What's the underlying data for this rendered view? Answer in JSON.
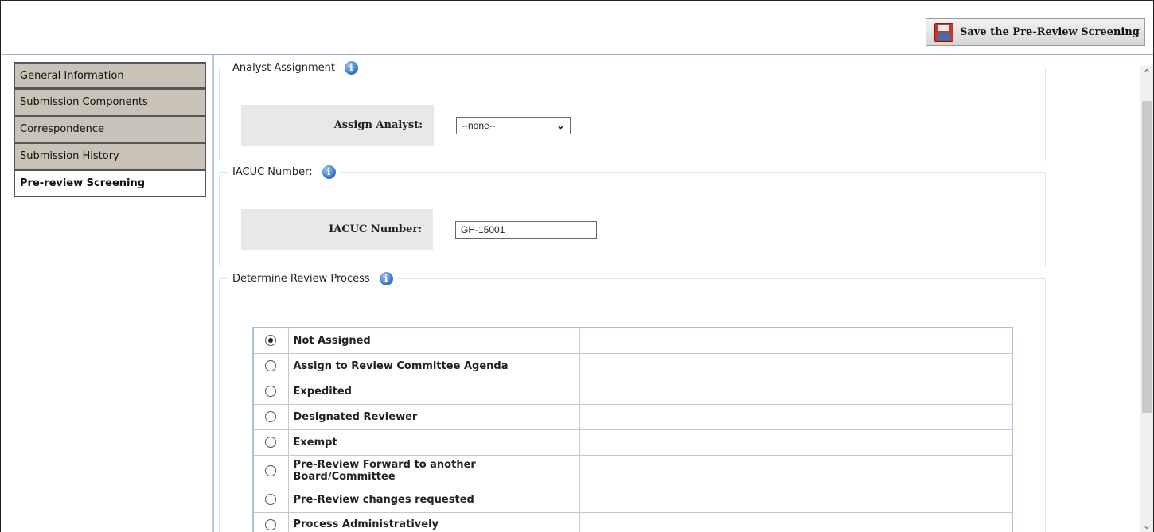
{
  "toolbar": {
    "save_label": "Save the Pre-Review Screening"
  },
  "sidebar": {
    "items": [
      {
        "label": "General Information"
      },
      {
        "label": "Submission Components"
      },
      {
        "label": "Correspondence"
      },
      {
        "label": "Submission History"
      },
      {
        "label": "Pre-review Screening",
        "active": true
      }
    ]
  },
  "analyst": {
    "legend": "Analyst Assignment",
    "label": "Assign Analyst:",
    "selected": "--none--"
  },
  "iacuc": {
    "legend": "IACUC Number:",
    "label": "IACUC Number:",
    "value": "GH-15001"
  },
  "review": {
    "legend": "Determine Review Process",
    "selected_index": 0,
    "options": [
      "Not Assigned",
      "Assign to Review Committee Agenda",
      "Expedited",
      "Designated Reviewer",
      "Exempt",
      "Pre-Review Forward to another Board/Committee",
      "Pre-Review changes requested",
      "Process Administratively"
    ]
  },
  "icons": {
    "save": "floppy-disk-icon",
    "info": "info-icon",
    "dropdown": "chevron-down-icon"
  }
}
